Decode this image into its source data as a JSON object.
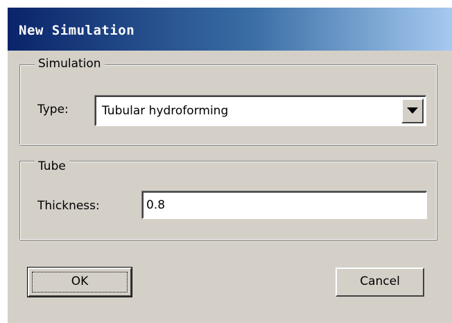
{
  "window": {
    "title": "New Simulation"
  },
  "simulation_group": {
    "legend": "Simulation",
    "type_label": "Type:",
    "type_value": "Tubular hydroforming",
    "dropdown_icon": "chevron-down-icon"
  },
  "tube_group": {
    "legend": "Tube",
    "thickness_label": "Thickness:",
    "thickness_value": "0.8"
  },
  "buttons": {
    "ok_label": "OK",
    "cancel_label": "Cancel"
  },
  "colors": {
    "dialog_face": "#d4d0c8",
    "titlebar_start": "#0a246a",
    "titlebar_end": "#a6caf0",
    "title_text": "#ffffff"
  }
}
